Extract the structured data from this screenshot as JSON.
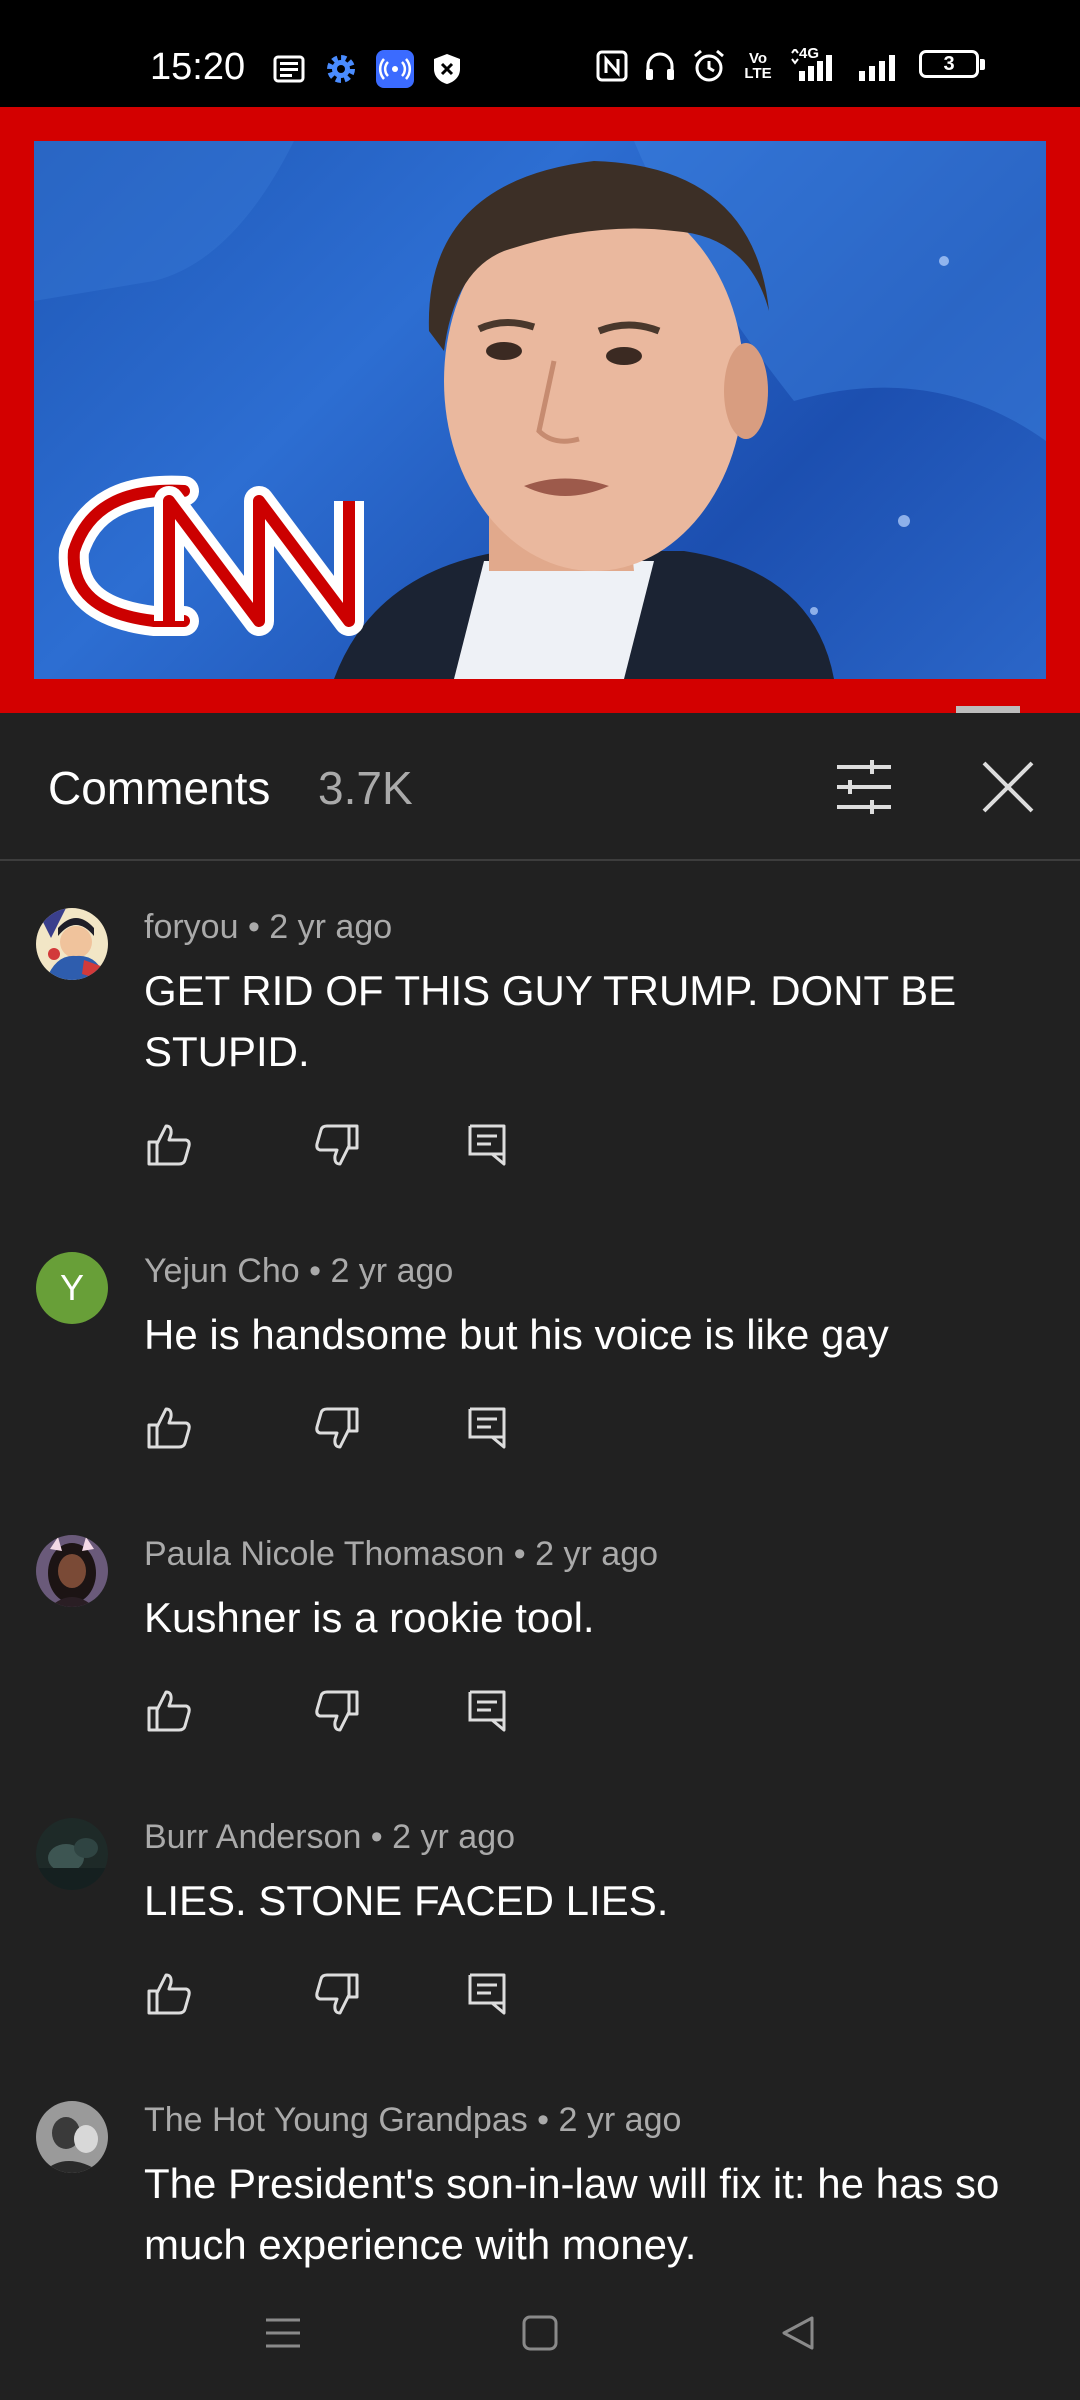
{
  "status_bar": {
    "time": "15:20",
    "left_icons": [
      "news-icon",
      "settings-icon",
      "hotspot-icon",
      "shield-icon"
    ],
    "right_icons": [
      "nfc-icon",
      "headphones-icon",
      "alarm-icon",
      "volte-icon",
      "4g-signal-icon",
      "signal-icon",
      "battery-icon"
    ],
    "volte_label": "Vo LTE",
    "network_label": "4G",
    "battery_level": "3"
  },
  "video": {
    "logo_text": "CNN",
    "frame_color": "#d30000"
  },
  "comments_header": {
    "title": "Comments",
    "count": "3.7K"
  },
  "comments": [
    {
      "author": "foryou",
      "age": "2 yr ago",
      "text": "GET RID OF THIS GUY TRUMP. DONT BE STUPID.",
      "avatar_icon": "cartoon-avatar"
    },
    {
      "author": "Yejun Cho",
      "age": "2 yr ago",
      "text": "He is handsome but his voice is like gay",
      "avatar_letter": "Y",
      "avatar_color": "#689f38"
    },
    {
      "author": "Paula Nicole Thomason",
      "age": "2 yr ago",
      "text": "Kushner is a rookie tool.",
      "avatar_icon": "photo-avatar"
    },
    {
      "author": "Burr Anderson",
      "age": "2 yr ago",
      "text": "LIES. STONE FACED LIES.",
      "avatar_icon": "photo-avatar"
    },
    {
      "author": "The Hot Young Grandpas",
      "age": "2 yr ago",
      "text": "The President's son-in-law will fix it: he has so much experience with money.",
      "avatar_icon": "photo-avatar"
    }
  ],
  "separator": " • ",
  "nav_bar": [
    "menu-icon",
    "home-icon",
    "back-icon"
  ]
}
